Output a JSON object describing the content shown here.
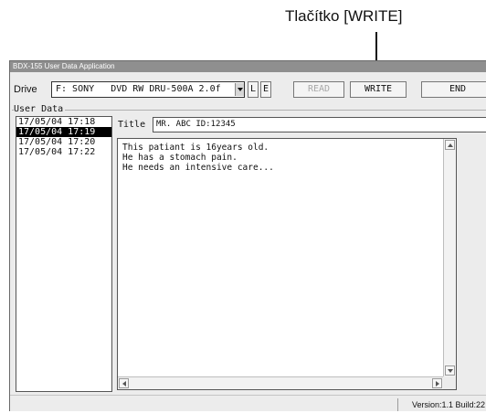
{
  "annotation": {
    "label": "Tlačítko [WRITE]"
  },
  "window": {
    "title": "BDX-155 User Data Application"
  },
  "drive": {
    "label": "Drive",
    "value": "F: SONY   DVD RW DRU-500A 2.0f"
  },
  "buttons": {
    "l": "L",
    "e": "E",
    "read": "READ",
    "write": "WRITE",
    "end": "END"
  },
  "user_data": {
    "label": "User Data",
    "entries": [
      "17/05/04 17:18",
      "17/05/04 17:19",
      "17/05/04 17:20",
      "17/05/04 17:22"
    ],
    "selected_index": 1
  },
  "record": {
    "title_label": "Title",
    "title_value": "MR. ABC ID:12345",
    "body": "This patiant is 16years old.\nHe has a stomach pain.\nHe needs an intensive care..."
  },
  "status": {
    "version": "Version:1.1 Build:22"
  },
  "icons": {
    "drive_dropdown": "chevron-down-icon",
    "scroll_up": "arrow-up-icon",
    "scroll_down": "arrow-down-icon",
    "scroll_left": "arrow-left-icon",
    "scroll_right": "arrow-right-icon"
  }
}
